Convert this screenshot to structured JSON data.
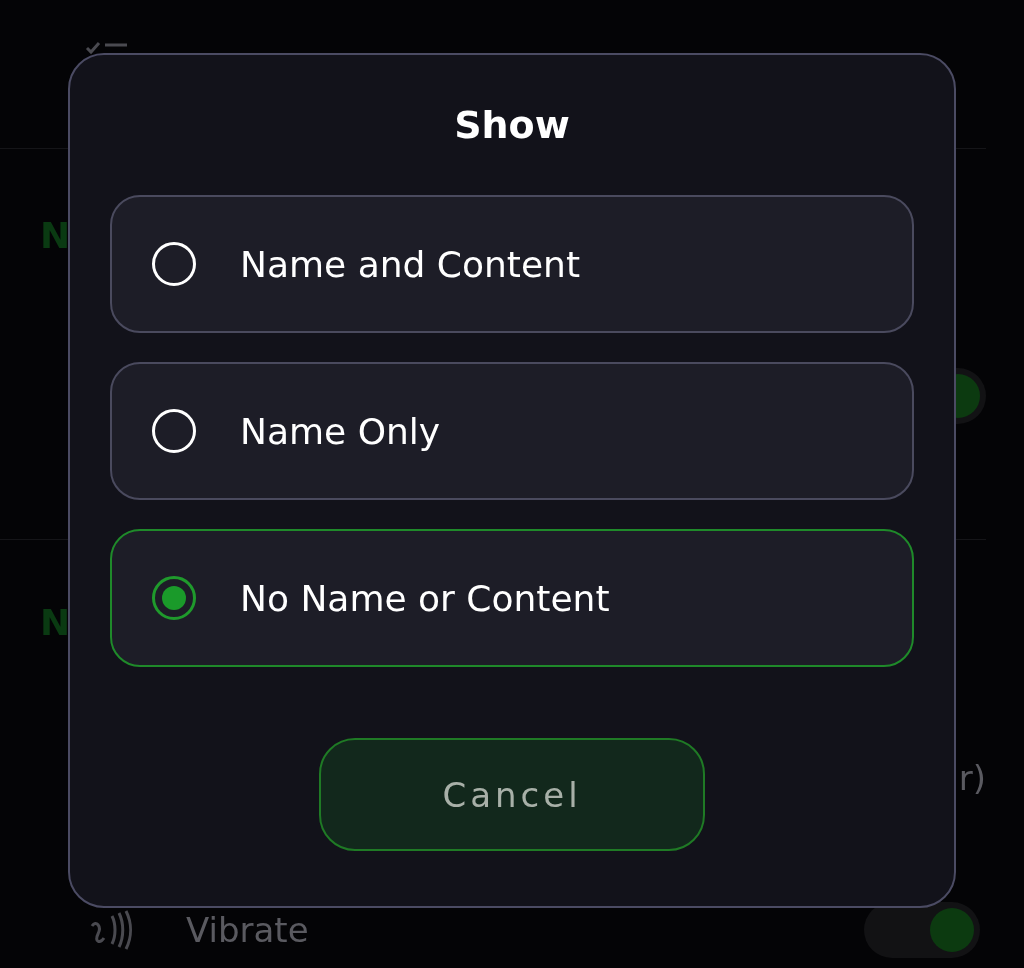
{
  "background": {
    "section_headers": [
      "N",
      "N"
    ],
    "toggle": {
      "on": true
    },
    "row_text_fragment": "r)",
    "vibrate": {
      "label": "Vibrate",
      "on": true
    }
  },
  "dialog": {
    "title": "Show",
    "options": [
      {
        "label": "Name and Content",
        "selected": false
      },
      {
        "label": "Name Only",
        "selected": false
      },
      {
        "label": "No Name or Content",
        "selected": true
      }
    ],
    "cancel": "Cancel"
  }
}
